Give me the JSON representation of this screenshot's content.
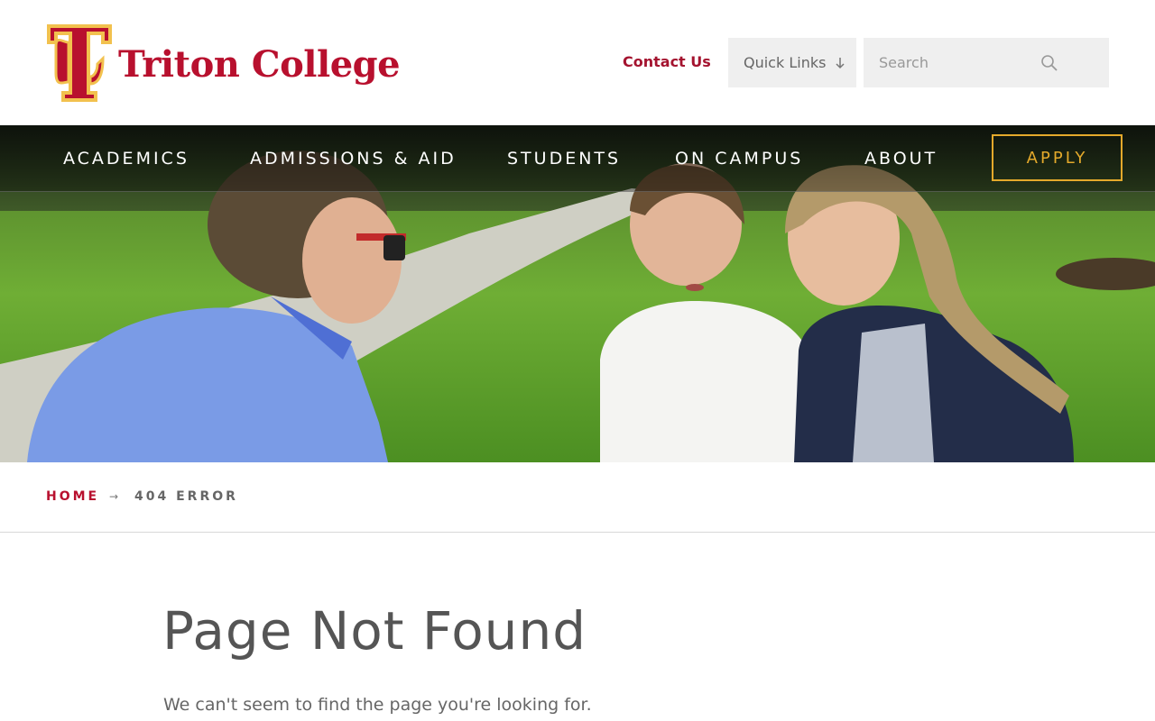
{
  "brand": {
    "name": "Triton College",
    "primary_color": "#b8102e",
    "accent_color": "#e4a92b",
    "logo_icon": "tc-monogram-logo"
  },
  "header": {
    "contact_label": "Contact Us",
    "quick_links_label": "Quick Links",
    "search_placeholder": "Search",
    "search_icon": "search-icon"
  },
  "nav": {
    "items": [
      {
        "label": "ACADEMICS"
      },
      {
        "label": "ADMISSIONS & AID"
      },
      {
        "label": "STUDENTS"
      },
      {
        "label": "ON CAMPUS"
      },
      {
        "label": "ABOUT"
      }
    ],
    "apply_label": "APPLY"
  },
  "breadcrumb": {
    "home": "HOME",
    "separator": "→",
    "current": "404 ERROR"
  },
  "main": {
    "title": "Page Not Found",
    "message": "We can't seem to find the page you're looking for."
  }
}
